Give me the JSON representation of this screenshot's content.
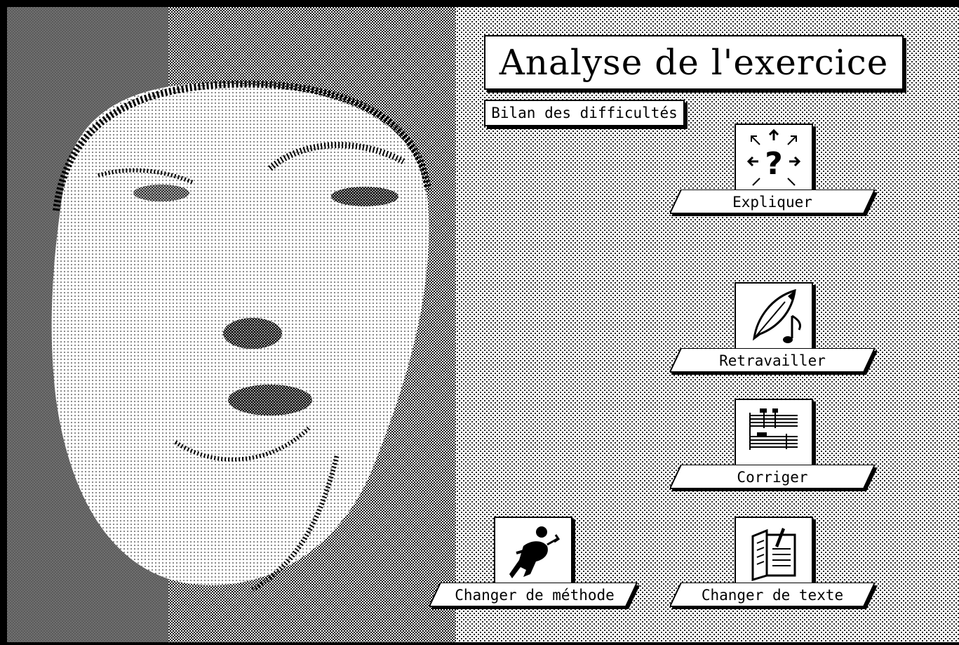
{
  "screen": {
    "title": "Analyse de l'exercice",
    "bilan_button": "Bilan des difficultés"
  },
  "tools": {
    "expliquer": {
      "label": "Expliquer",
      "icon": "question-arrows-icon"
    },
    "retravailler": {
      "label": "Retravailler",
      "icon": "quill-note-icon"
    },
    "corriger": {
      "label": "Corriger",
      "icon": "score-sheet-icon"
    },
    "changer_methode": {
      "label": "Changer de méthode",
      "icon": "running-man-icon"
    },
    "changer_texte": {
      "label": "Changer de texte",
      "icon": "open-book-icon"
    }
  },
  "colors": {
    "ink": "#000000",
    "paper": "#ffffff"
  }
}
